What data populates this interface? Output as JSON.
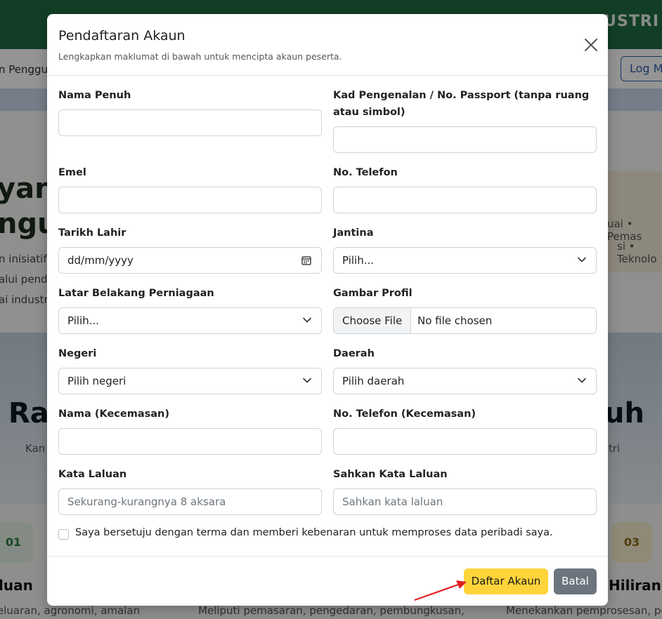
{
  "background": {
    "brand": "USTRI",
    "nav_text": "n Penggu",
    "login": "Log M",
    "hero_line1": "yan",
    "hero_line2": "ngu",
    "hero_p1": "n inisiatif",
    "hero_p2": "alui pende",
    "hero_p3": "ai industri",
    "right_text1": "uai • Pemas",
    "right_text2": "si • Teknolo",
    "big_left": "Ra",
    "big_right": "uh",
    "sub_left": "Kan",
    "sub_right": "tri",
    "num_left": "01",
    "num_right": "03",
    "title_left": "luan",
    "title_right": "Hiliran",
    "desc_left": "eluaran, agronomi, amalan",
    "desc_mid": "Meliputi pemasaran, pengedaran, pembungkusan,",
    "desc_right": "Menekankan pemprosesan, pen"
  },
  "modal": {
    "title": "Pendaftaran Akaun",
    "subtitle": "Lengkapkan maklumat di bawah untuk mencipta akaun peserta.",
    "close_icon": "close-icon"
  },
  "form": {
    "full_name_label": "Nama Penuh",
    "ic_label": "Kad Pengenalan / No. Passport (tanpa ruang atau simbol)",
    "email_label": "Emel",
    "phone_label": "No. Telefon",
    "dob_label": "Tarikh Lahir",
    "dob_value": "dd/mm/yyyy",
    "gender_label": "Jantina",
    "gender_value": "Pilih...",
    "business_label": "Latar Belakang Perniagaan",
    "business_value": "Pilih...",
    "photo_label": "Gambar Profil",
    "photo_button": "Choose File",
    "photo_status": "No file chosen",
    "state_label": "Negeri",
    "state_value": "Pilih negeri",
    "district_label": "Daerah",
    "district_value": "Pilih daerah",
    "emergency_name_label": "Nama (Kecemasan)",
    "emergency_phone_label": "No. Telefon (Kecemasan)",
    "password_label": "Kata Laluan",
    "password_placeholder": "Sekurang-kurangnya 8 aksara",
    "confirm_label": "Sahkan Kata Laluan",
    "confirm_placeholder": "Sahkan kata laluan",
    "consent": "Saya bersetuju dengan terma dan memberi kebenaran untuk memproses data peribadi saya."
  },
  "footer": {
    "submit": "Daftar Akaun",
    "cancel": "Batal"
  },
  "colors": {
    "primary_button": "#ffd43b",
    "cancel_button": "#6c757d",
    "annotation_arrow": "#e02020"
  }
}
